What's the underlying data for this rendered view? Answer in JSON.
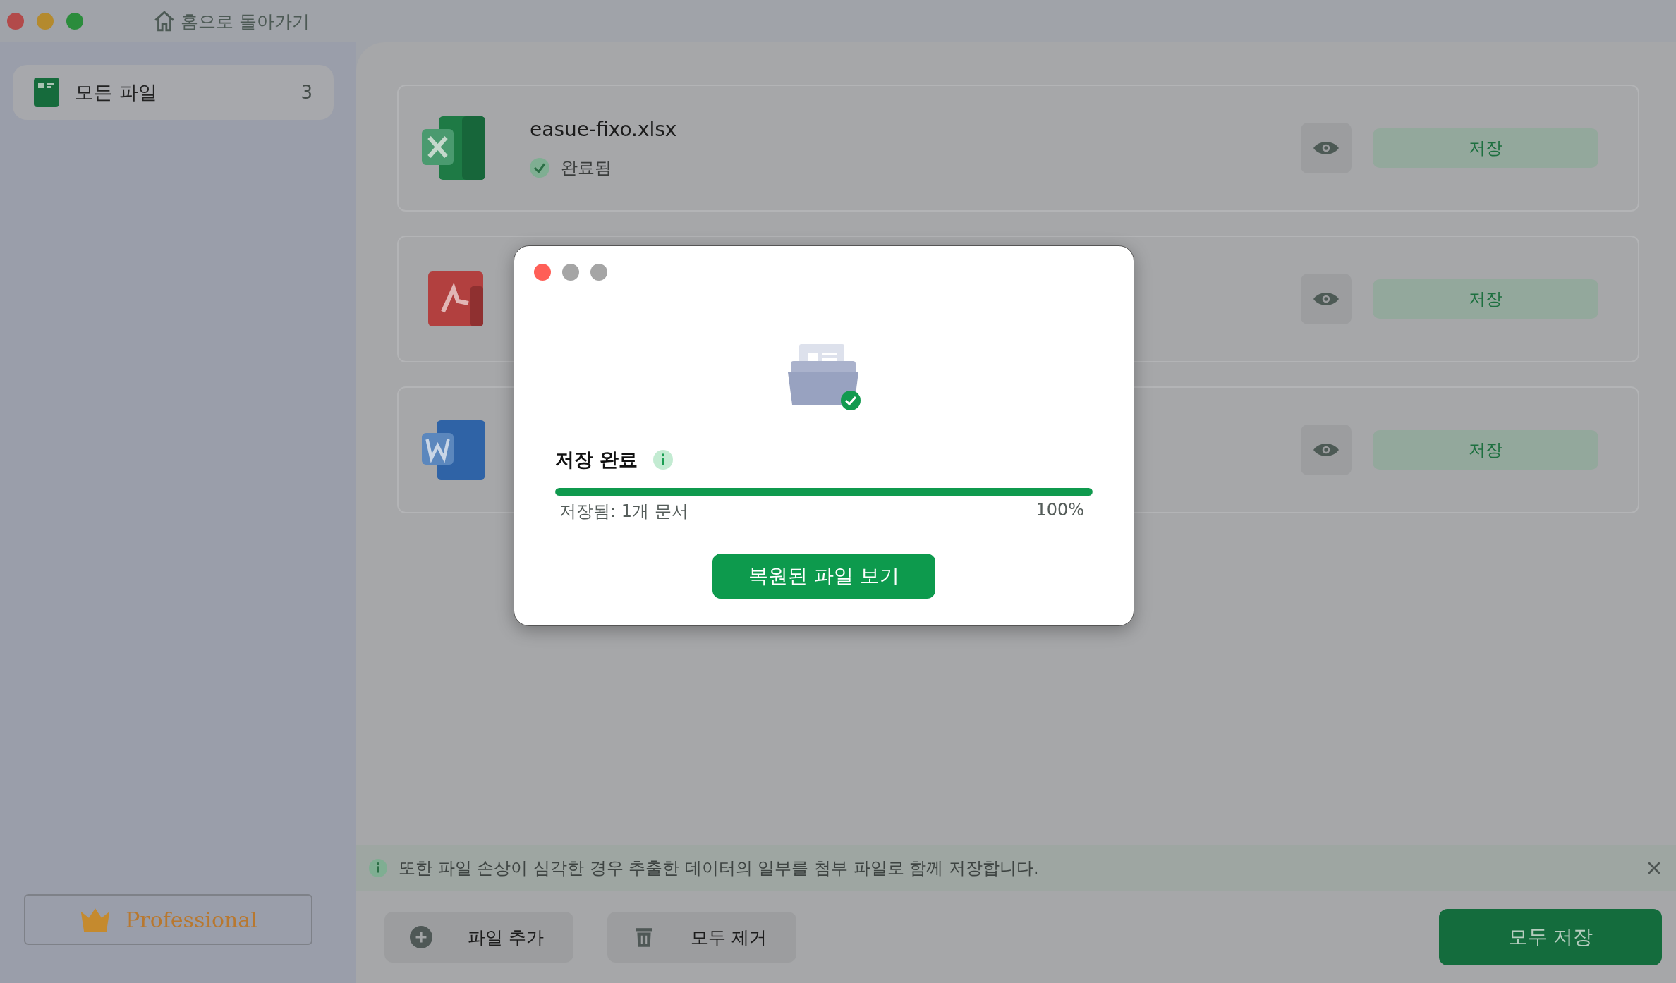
{
  "window": {
    "back_label": "홈으로 돌아가기"
  },
  "sidebar": {
    "items": [
      {
        "label": "모든 파일",
        "count": "3",
        "selected": true
      }
    ],
    "edition": "Professional"
  },
  "files": [
    {
      "kind": "xlsx",
      "name": "easue-fixo.xlsx",
      "status": "완료됨",
      "save_label": "저장"
    },
    {
      "kind": "pdf",
      "save_label": "저장"
    },
    {
      "kind": "docx",
      "save_label": "저장"
    }
  ],
  "notice": {
    "text": "또한 파일 손상이 심각한 경우 추출한 데이터의 일부를 첨부 파일로 함께 저장합니다."
  },
  "toolbar": {
    "add": "파일 추가",
    "remove": "모두 제거",
    "save_all": "모두 저장"
  },
  "dialog": {
    "title": "저장 완료",
    "progress": {
      "level": 1.0
    },
    "saved_text": "저장됨: 1개 문서",
    "percent": "100%",
    "button": "복원된 파일 보기"
  }
}
